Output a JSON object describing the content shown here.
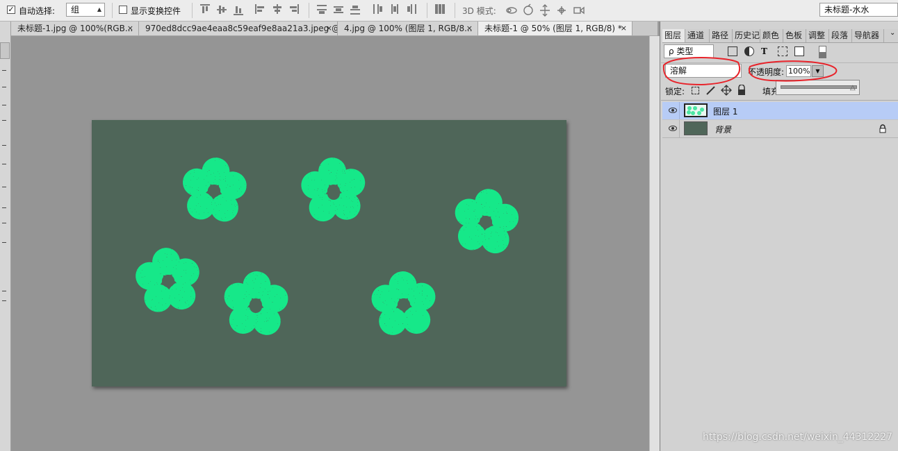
{
  "options_bar": {
    "auto_select_label": "自动选择:",
    "auto_select_value": "组",
    "show_transform_label": "显示变换控件",
    "mode_3d_label": "3D 模式:",
    "workspace_value": "未标题-水水"
  },
  "documents": {
    "tabs": [
      {
        "label": "未标题-1.jpg @ 100%(RGB...",
        "close": "×"
      },
      {
        "label": "970ed8dcc9ae4eaa8c59eaf9e8aa21a3.jpeg @...",
        "close": "×"
      },
      {
        "label": "4.jpg @ 100% (图层 1, RGB/8...",
        "close": "×"
      },
      {
        "label": "未标题-1 @ 50% (图层 1, RGB/8) *",
        "close": "×"
      }
    ],
    "active_index": 3
  },
  "layers_panel": {
    "tabs": [
      "图层",
      "通道",
      "路径",
      "历史记",
      "颜色",
      "色板",
      "调整",
      "段落",
      "导航器"
    ],
    "filter_label": "ρ 类型",
    "blend_mode": "溶解",
    "opacity_label": "不透明度:",
    "opacity_value": "100%",
    "opacity_level": 1.0,
    "lock_label": "锁定:",
    "fill_label": "填充",
    "layers": [
      {
        "name": "图层 1",
        "selected": true,
        "visible": true
      },
      {
        "name": "背景",
        "selected": false,
        "visible": true,
        "locked": true
      }
    ]
  },
  "watermark": "https://blog.csdn.net/weixin_44312227",
  "colors": {
    "canvas_bg": "#4f6659",
    "flower": "#14e889",
    "selection": "#b7ccf6",
    "annotation": "#e8232a"
  },
  "icons": {
    "close": "×",
    "combo_arrow": "⬍",
    "lock": "🔒"
  }
}
